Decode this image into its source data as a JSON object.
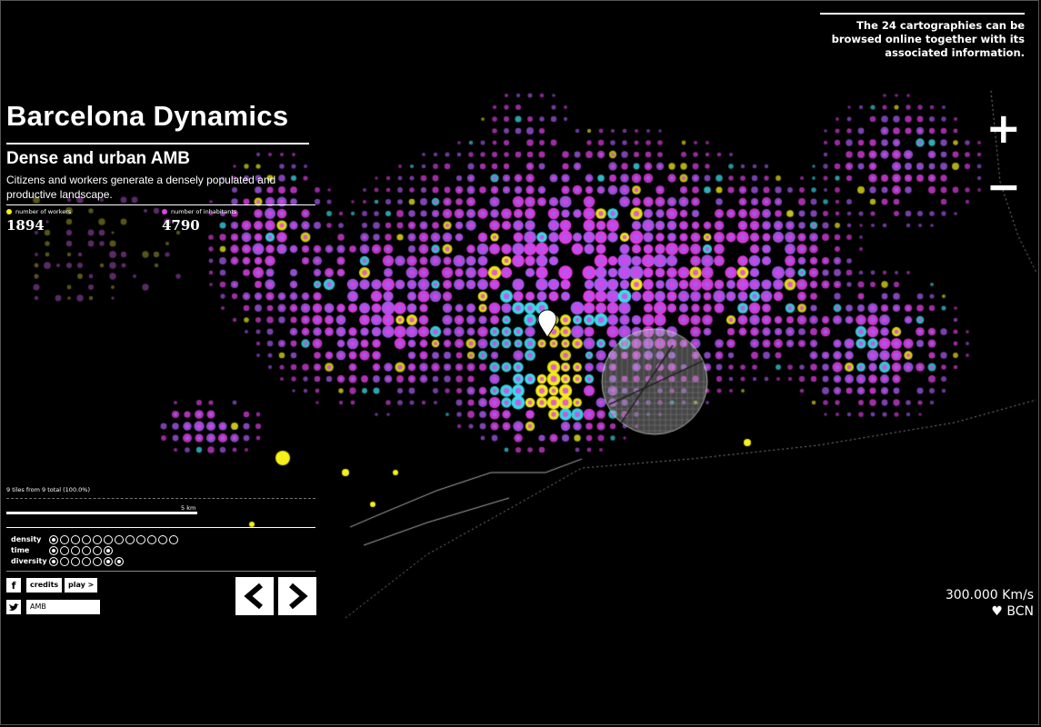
{
  "top_note": "The 24 cartographies can be browsed online together with its associated information.",
  "title": "Barcelona Dynamics",
  "subtitle": "Dense and urban AMB",
  "description": "Citizens and workers generate a densely populated and productive landscape.",
  "stats": {
    "workers_label": "number of workers",
    "workers_value": "1894",
    "inhabitants_label": "number of inhabitants",
    "inhabitants_value": "4790"
  },
  "tiles_info": "9 tiles from 9 total (100.0%)",
  "scale_label": "5 km",
  "filters": [
    {
      "label": "density",
      "count": 12,
      "on": [
        0
      ]
    },
    {
      "label": "time",
      "count": 6,
      "on": [
        0,
        5
      ]
    },
    {
      "label": "diversity",
      "count": 7,
      "on": [
        0,
        5,
        6
      ]
    }
  ],
  "buttons": {
    "facebook_icon": "f",
    "credits": "credits",
    "play": "play >",
    "twitter_icon": "t",
    "search_value": "AMB",
    "prev": "<",
    "next": ">",
    "zoom_in": "+",
    "zoom_out": "−"
  },
  "footer": {
    "speed": "300.000 Km/s",
    "bcn": "♥ BCN"
  },
  "colors": {
    "background": "#000000",
    "magenta": "#e040e8",
    "violet": "#a85cf0",
    "cyan": "#3ee0f0",
    "yellow": "#f5f01a",
    "workers_dot": "#f5f01a",
    "inhabitants_dot": "#e040e8"
  },
  "icons": [
    "facebook-icon",
    "twitter-icon",
    "map-pin-icon",
    "prev-arrow-icon",
    "next-arrow-icon",
    "zoom-in-icon",
    "zoom-out-icon"
  ]
}
